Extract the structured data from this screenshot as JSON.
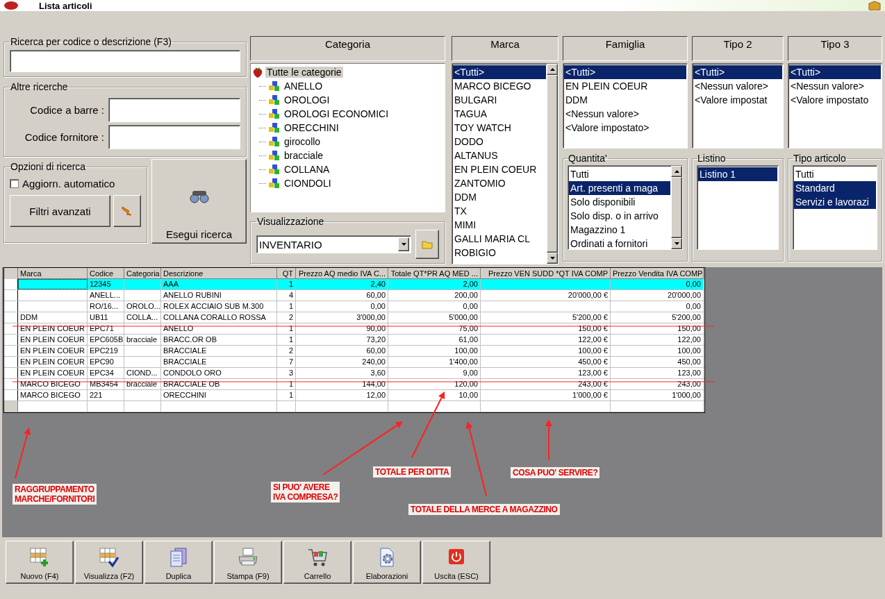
{
  "window": {
    "title": "Lista articoli"
  },
  "search_group": {
    "title": "Ricerca per codice o descrizione (F3)"
  },
  "other_searches": {
    "title": "Altre ricerche",
    "fields": [
      {
        "label": "Codice a barre :"
      },
      {
        "label": "Codice fornitore :"
      }
    ]
  },
  "search_options": {
    "title": "Opzioni di ricerca",
    "auto_update": {
      "label": "Aggiorn. automatico",
      "checked": false
    },
    "advanced_filters_button": "Filtri avanzati"
  },
  "run_search_button": "Esegui ricerca",
  "categoria": {
    "header": "Categoria",
    "tree": [
      {
        "label": "Tutte le categorie",
        "selected": true,
        "children": [
          {
            "label": "ANELLO",
            "selected": false
          },
          {
            "label": "OROLOGI",
            "selected": false
          },
          {
            "label": "OROLOGI ECONOMICI",
            "selected": false
          },
          {
            "label": "ORECCHINI",
            "selected": false
          },
          {
            "label": "girocollo",
            "selected": false
          },
          {
            "label": "bracciale",
            "selected": false
          },
          {
            "label": "COLLANA",
            "selected": false
          },
          {
            "label": "CIONDOLI",
            "selected": false
          }
        ]
      }
    ]
  },
  "visualizzazione": {
    "title": "Visualizzazione",
    "value": "INVENTARIO"
  },
  "marca": {
    "header": "Marca",
    "items": [
      {
        "label": "<Tutti>",
        "selected": true
      },
      {
        "label": "MARCO BICEGO",
        "selected": false
      },
      {
        "label": "BULGARI",
        "selected": false
      },
      {
        "label": "TAGUA",
        "selected": false
      },
      {
        "label": "TOY WATCH",
        "selected": false
      },
      {
        "label": "DODO",
        "selected": false
      },
      {
        "label": "ALTANUS",
        "selected": false
      },
      {
        "label": "EN PLEIN COEUR",
        "selected": false
      },
      {
        "label": "ZANTOMIO",
        "selected": false
      },
      {
        "label": "DDM",
        "selected": false
      },
      {
        "label": "TX",
        "selected": false
      },
      {
        "label": "MIMI",
        "selected": false
      },
      {
        "label": "GALLI MARIA CL",
        "selected": false
      },
      {
        "label": "ROBIGIO",
        "selected": false
      }
    ]
  },
  "famiglia": {
    "header": "Famiglia",
    "items": [
      {
        "label": "<Tutti>",
        "selected": true
      },
      {
        "label": "EN PLEIN COEUR",
        "selected": false
      },
      {
        "label": "DDM",
        "selected": false
      },
      {
        "label": "<Nessun valore>",
        "selected": false
      },
      {
        "label": "<Valore impostato>",
        "selected": false
      }
    ]
  },
  "tipo_2": {
    "header": "Tipo 2",
    "items": [
      {
        "label": "<Tutti>",
        "selected": true
      },
      {
        "label": "<Nessun valore>",
        "selected": false
      },
      {
        "label": "<Valore impostat",
        "selected": false
      }
    ]
  },
  "tipo_3": {
    "header": "Tipo 3",
    "items": [
      {
        "label": "<Tutti>",
        "selected": true
      },
      {
        "label": "<Nessun valore>",
        "selected": false
      },
      {
        "label": "<Valore impostato",
        "selected": false
      }
    ]
  },
  "quantita": {
    "title": "Quantita'",
    "items": [
      {
        "label": "Tutti",
        "selected": false
      },
      {
        "label": "Art. presenti a maga",
        "selected": true
      },
      {
        "label": "Solo disponibili",
        "selected": false
      },
      {
        "label": "Solo disp. o in arrivo",
        "selected": false
      },
      {
        "label": "Magazzino 1",
        "selected": false
      },
      {
        "label": "Ordinati a fornitori",
        "selected": false
      }
    ]
  },
  "listino": {
    "title": "Listino",
    "items": [
      {
        "label": "Listino 1",
        "selected": true
      }
    ]
  },
  "tipo_articolo": {
    "title": "Tipo articolo",
    "items": [
      {
        "label": "Tutti",
        "selected": false
      },
      {
        "label": "Standard",
        "selected": true
      },
      {
        "label": "Servizi e lavorazi",
        "selected": true
      }
    ]
  },
  "table": {
    "columns": [
      "Marca",
      "Codice",
      "Categoria",
      "Descrizione",
      "QT",
      "Prezzo AQ medio IVA C...",
      "Totale QT*PR AQ MED ...",
      "Prezzo VEN SUDD *QT IVA COMP",
      "Prezzo Vendita IVA COMP"
    ],
    "rows": [
      {
        "selected": true,
        "cells": [
          null,
          "12345",
          null,
          "AAA",
          "1",
          "2,40",
          "2,00",
          null,
          "0,00"
        ]
      },
      {
        "selected": false,
        "cells": [
          null,
          "ANELL...",
          null,
          "ANELLO RUBINI",
          "4",
          "60,00",
          "200,00",
          "20'000,00 €",
          "20'000,00"
        ]
      },
      {
        "selected": false,
        "cells": [
          null,
          "RO/16...",
          "OROLO...",
          "ROLEX  ACCIAIO SUB M.300",
          "1",
          "0,00",
          "0,00",
          null,
          "0,00"
        ]
      },
      {
        "selected": false,
        "cells": [
          "DDM",
          "UB11",
          "COLLA...",
          "COLLANA CORALLO ROSSA",
          "2",
          "3'000,00",
          "5'000,00",
          "5'200,00 €",
          "5'200,00"
        ]
      },
      {
        "selected": false,
        "cells": [
          "EN PLEIN COEUR",
          "EPC71",
          null,
          "ANELLO",
          "1",
          "90,00",
          "75,00",
          "150,00 €",
          "150,00"
        ]
      },
      {
        "selected": false,
        "cells": [
          "EN PLEIN COEUR",
          "EPC605B",
          "bracciale",
          "BRACC.OR OB",
          "1",
          "73,20",
          "61,00",
          "122,00 €",
          "122,00"
        ]
      },
      {
        "selected": false,
        "cells": [
          "EN PLEIN COEUR",
          "EPC219",
          null,
          "BRACCIALE",
          "2",
          "60,00",
          "100,00",
          "100,00 €",
          "100,00"
        ]
      },
      {
        "selected": false,
        "cells": [
          "EN PLEIN COEUR",
          "EPC90",
          null,
          "BRACCIALE",
          "7",
          "240,00",
          "1'400,00",
          "450,00 €",
          "450,00"
        ]
      },
      {
        "selected": false,
        "cells": [
          "EN PLEIN COEUR",
          "EPC34",
          "CIOND...",
          "CONDOLO ORO",
          "3",
          "3,60",
          "9,00",
          "123,00 €",
          "123,00"
        ]
      },
      {
        "selected": false,
        "cells": [
          "MARCO BICEGO",
          "MB3454",
          "bracciale",
          "BRACCIALE OB",
          "1",
          "144,00",
          "120,00",
          "243,00 €",
          "243,00"
        ]
      },
      {
        "selected": false,
        "cells": [
          "MARCO BICEGO",
          "221",
          null,
          "ORECCHINI",
          "1",
          "12,00",
          "10,00",
          "1'000,00 €",
          "1'000,00"
        ]
      }
    ]
  },
  "annotations": [
    {
      "text": "RAGGRUPPAMENTO\nMARCHE/FORNITORI"
    },
    {
      "text": "SI PUO' AVERE\nIVA COMPRESA?"
    },
    {
      "text": "TOTALE PER DITTA"
    },
    {
      "text": "TOTALE DELLA MERCE A MAGAZZINO"
    },
    {
      "text": "COSA PUO' SERVIRE?"
    }
  ],
  "toolbar": [
    {
      "label": "Nuovo (F4)",
      "kind": "new"
    },
    {
      "label": "Visualizza (F2)",
      "kind": "view"
    },
    {
      "label": "Duplica",
      "kind": "duplicate"
    },
    {
      "label": "Stampa (F9)",
      "kind": "print"
    },
    {
      "label": "Carrello",
      "kind": "cart"
    },
    {
      "label": "Elaborazioni",
      "kind": "process"
    },
    {
      "label": "Uscita (ESC)",
      "kind": "exit"
    }
  ]
}
